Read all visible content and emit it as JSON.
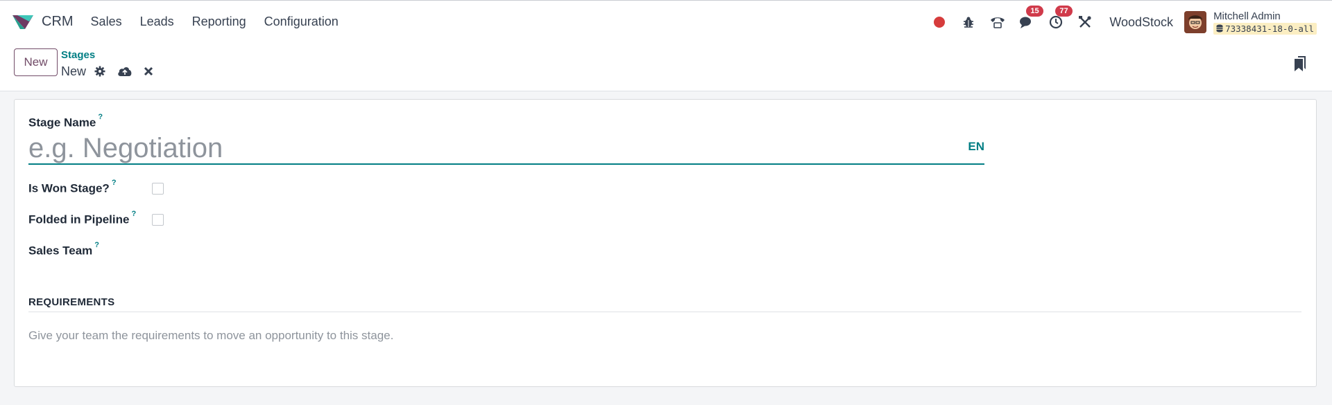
{
  "app": {
    "name": "CRM",
    "brand_color": "#714b67",
    "accent_color": "#017e84"
  },
  "menu": [
    {
      "label": "Sales"
    },
    {
      "label": "Leads"
    },
    {
      "label": "Reporting"
    },
    {
      "label": "Configuration"
    }
  ],
  "systray": {
    "recording_icon": "record-dot-icon",
    "debug_icon": "bug-icon",
    "phone_icon": "phone-icon",
    "messages_icon": "chat-icon",
    "messages_count": "15",
    "activities_icon": "clock-icon",
    "activities_count": "77",
    "settings_icon": "tools-icon",
    "company": "WoodStock",
    "user_name": "Mitchell Admin",
    "database": "73338431-18-0-all"
  },
  "control_panel": {
    "new_button": "New",
    "breadcrumb": "Stages",
    "record_name": "New",
    "actions": [
      "gear-icon",
      "cloud-upload-icon",
      "close-icon"
    ]
  },
  "form": {
    "stage_name_label": "Stage Name",
    "stage_name_value": "",
    "stage_name_placeholder": "e.g. Negotiation",
    "lang_label": "EN",
    "is_won_label": "Is Won Stage?",
    "is_won_checked": false,
    "folded_label": "Folded in Pipeline",
    "folded_checked": false,
    "sales_team_label": "Sales Team",
    "help_mark": "?",
    "requirements_title": "REQUIREMENTS",
    "requirements_placeholder": "Give your team the requirements to move an opportunity to this stage."
  }
}
